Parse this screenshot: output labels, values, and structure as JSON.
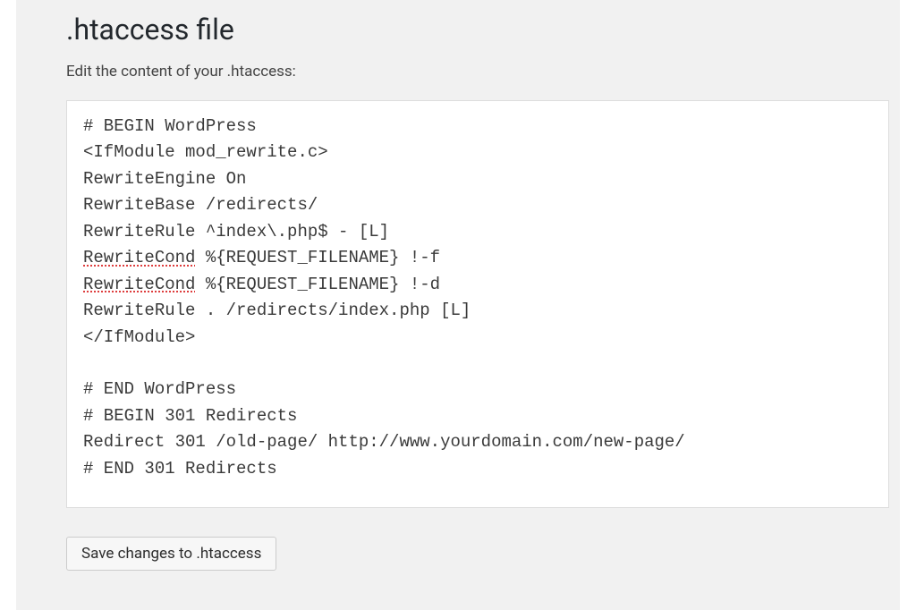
{
  "page": {
    "title": ".htaccess file",
    "instruction": "Edit the content of your .htaccess:"
  },
  "editor": {
    "lines": [
      "# BEGIN WordPress",
      "<IfModule mod_rewrite.c>",
      "RewriteEngine On",
      "RewriteBase /redirects/",
      "RewriteRule ^index\\.php$ - [L]",
      "RewriteCond %{REQUEST_FILENAME} !-f",
      "RewriteCond %{REQUEST_FILENAME} !-d",
      "RewriteRule . /redirects/index.php [L]",
      "</IfModule>",
      "",
      "# END WordPress",
      "# BEGIN 301 Redirects",
      "Redirect 301 /old-page/ http://www.yourdomain.com/new-page/",
      "# END 301 Redirects"
    ],
    "spellcheck_words": [
      "RewriteCond"
    ]
  },
  "actions": {
    "save_label": "Save changes to .htaccess"
  }
}
